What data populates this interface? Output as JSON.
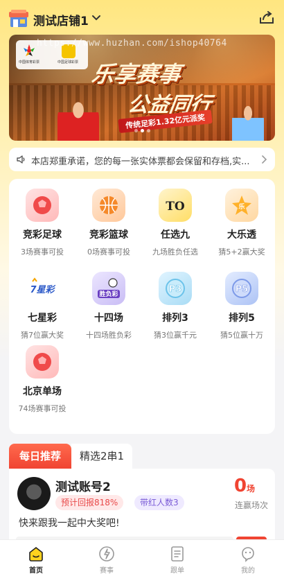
{
  "header": {
    "shop_name": "测试店铺1"
  },
  "banner": {
    "watermark": "https://www.huzhan.com/ishop40764",
    "logo_left_caption": "中国体育彩票",
    "logo_right_caption": "中国足球彩票",
    "headline_line1": "乐享赛事",
    "headline_line2": "公益同行",
    "ribbon": "传统足彩1.32亿元派奖",
    "slide_count": 3,
    "active_slide": 1
  },
  "notice": {
    "text": "本店郑重承诺，您的每一张实体票都会保留和存档,实..."
  },
  "lotteries": [
    {
      "name": "竞彩足球",
      "desc": "3场赛事可投",
      "icon": "football-icon",
      "color": "red"
    },
    {
      "name": "竞彩篮球",
      "desc": "0场赛事可投",
      "icon": "basketball-icon",
      "color": "orange"
    },
    {
      "name": "任选九",
      "desc": "九场胜负任选",
      "icon": "ren-xuan-jiu-icon",
      "color": "yellow"
    },
    {
      "name": "大乐透",
      "desc": "猜5+2赢大奖",
      "icon": "da-le-tou-icon",
      "color": "lyellow"
    },
    {
      "name": "七星彩",
      "desc": "猜7位赢大奖",
      "icon": "qi-xing-cai-icon",
      "color": "white"
    },
    {
      "name": "十四场",
      "desc": "十四场胜负彩",
      "icon": "sheng-fu-cai-icon",
      "color": "purple"
    },
    {
      "name": "排列3",
      "desc": "猜3位赢千元",
      "icon": "pai-lie-3-icon",
      "color": "cyan"
    },
    {
      "name": "排列5",
      "desc": "猜5位赢十万",
      "icon": "pai-lie-5-icon",
      "color": "blue"
    },
    {
      "name": "北京单场",
      "desc": "74场赛事可投",
      "icon": "football-icon",
      "color": "red"
    }
  ],
  "icon_text": {
    "ren_xuan_jiu": "TO",
    "da_le_tou": "乐",
    "qi_xing_cai": "7星彩",
    "sheng_fu_cai": "胜负彩",
    "pai_lie_3": "P3",
    "pai_lie_5": "P5"
  },
  "recommend": {
    "tab_active": "每日推荐",
    "tab_other": "精选2串1",
    "username": "测试账号2",
    "tag_return": "预计回报818%",
    "tag_followers": "带红人数3",
    "streak_value": "0",
    "streak_unit": "场",
    "streak_label": "连赢场次",
    "slogan": "快来跟我一起中大奖吧!"
  },
  "nav": [
    {
      "label": "首页",
      "icon": "home-icon",
      "active": true
    },
    {
      "label": "赛事",
      "icon": "match-icon",
      "active": false
    },
    {
      "label": "跟单",
      "icon": "document-icon",
      "active": false
    },
    {
      "label": "我的",
      "icon": "profile-icon",
      "active": false
    }
  ],
  "colors": {
    "accent_red": "#f04432",
    "header_yellow": "#ffe680"
  }
}
